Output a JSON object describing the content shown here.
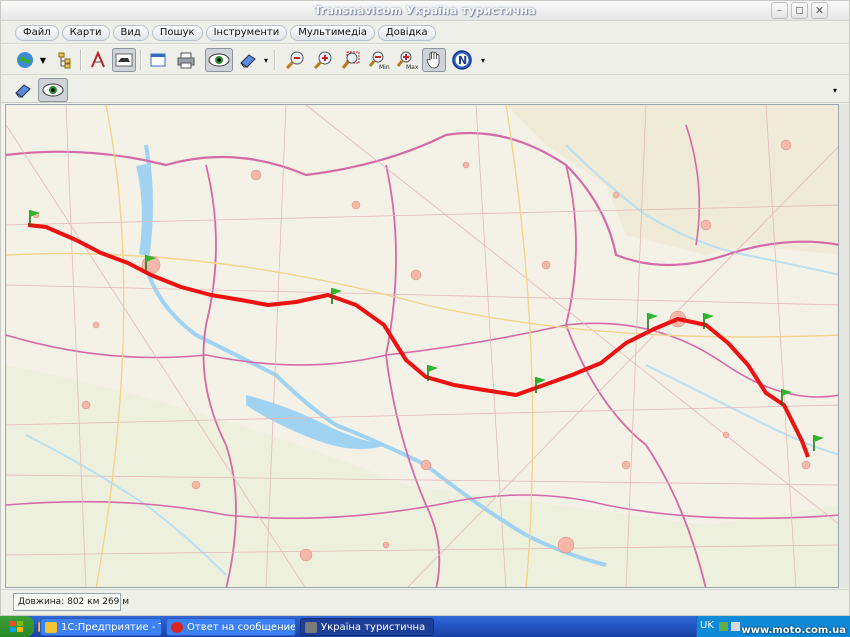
{
  "window": {
    "title": "Transnavicom Україна туристична"
  },
  "menu": [
    "Файл",
    "Карти",
    "Вид",
    "Пошук",
    "Інструменти",
    "Мультимедіа",
    "Довідка"
  ],
  "map": {
    "route_color": "#ee1111",
    "water_color": "#9fd3f1",
    "border_color": "#d46aa8",
    "background_color": "#f4f1e6"
  },
  "status": {
    "length_text": "Довжина: 802 км 269 м"
  },
  "taskbar": {
    "tasks": [
      {
        "label": "1С:Предприятие - То..."
      },
      {
        "label": "Ответ на сообщение..."
      },
      {
        "label": "Україна туристична"
      }
    ],
    "lang": "UK",
    "watermark": "www.moto.com.ua"
  }
}
